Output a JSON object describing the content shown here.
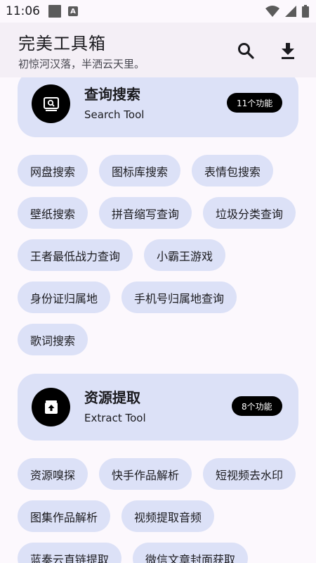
{
  "status_bar": {
    "time": "11:06",
    "a_icon": "A"
  },
  "app_bar": {
    "title": "完美工具箱",
    "subtitle": "初惊河汉落，半洒云天里。",
    "icons": [
      "search-icon",
      "download-icon"
    ]
  },
  "sections": [
    {
      "title": "查询搜索",
      "subtitle": "Search Tool",
      "badge": "11个功能",
      "icon": "search-box-icon",
      "items": [
        "网盘搜索",
        "图标库搜索",
        "表情包搜索",
        "壁纸搜索",
        "拼音缩写查询",
        "垃圾分类查询",
        "王者最低战力查询",
        "小霸王游戏",
        "身份证归属地",
        "手机号归属地查询",
        "歌词搜索"
      ]
    },
    {
      "title": "资源提取",
      "subtitle": "Extract Tool",
      "badge": "8个功能",
      "icon": "extract-box-icon",
      "items": [
        "资源嗅探",
        "快手作品解析",
        "短视频去水印",
        "图集作品解析",
        "视频提取音频",
        "蓝奏云直链提取",
        "微信文章封面获取"
      ]
    }
  ],
  "colors": {
    "card_bg": "#dce1f7",
    "badge_bg": "#000000",
    "app_bar_bg": "#f4eff6",
    "page_bg": "#fcf8fd"
  }
}
